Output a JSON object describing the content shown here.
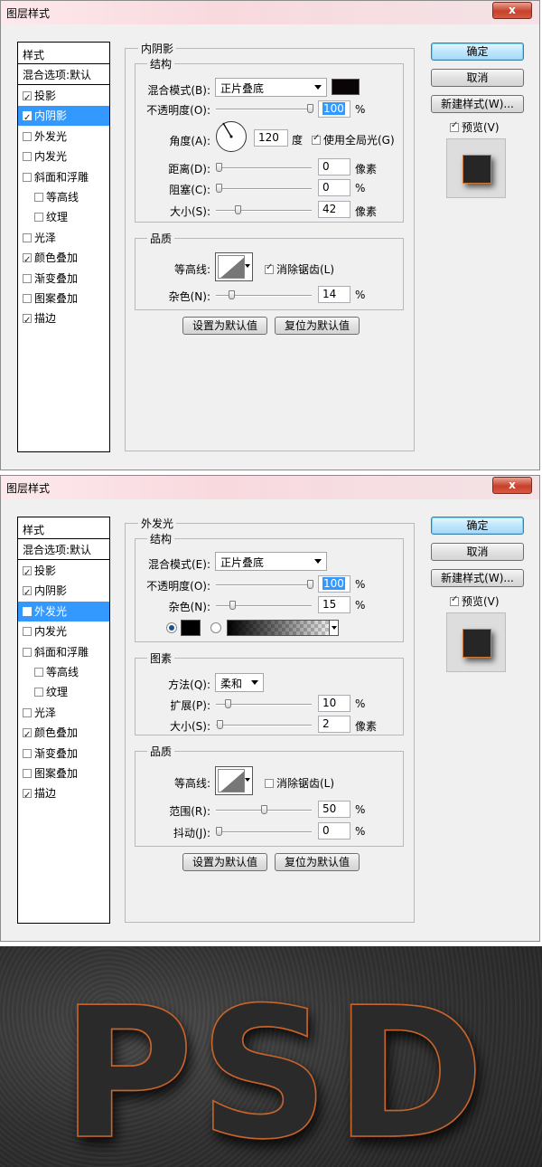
{
  "dialog_title": "图层样式",
  "close_glyph": "x",
  "style_list": {
    "header": "样式",
    "blend_default": "混合选项:默认",
    "items": [
      {
        "label": "投影",
        "checked": true,
        "indent": false
      },
      {
        "label": "内阴影",
        "checked": true,
        "indent": false
      },
      {
        "label": "外发光",
        "checked": false,
        "indent": false
      },
      {
        "label": "内发光",
        "checked": false,
        "indent": false
      },
      {
        "label": "斜面和浮雕",
        "checked": false,
        "indent": false
      },
      {
        "label": "等高线",
        "checked": false,
        "indent": true
      },
      {
        "label": "纹理",
        "checked": false,
        "indent": true
      },
      {
        "label": "光泽",
        "checked": false,
        "indent": false
      },
      {
        "label": "颜色叠加",
        "checked": true,
        "indent": false
      },
      {
        "label": "渐变叠加",
        "checked": false,
        "indent": false
      },
      {
        "label": "图案叠加",
        "checked": false,
        "indent": false
      },
      {
        "label": "描边",
        "checked": true,
        "indent": false
      }
    ]
  },
  "buttons": {
    "ok": "确定",
    "cancel": "取消",
    "new_style": "新建样式(W)...",
    "preview": "预览(V)",
    "set_default": "设置为默认值",
    "reset_default": "复位为默认值"
  },
  "dialog1": {
    "section": "内阴影",
    "selected_index": 1,
    "structure": {
      "legend": "结构",
      "blend_mode_label": "混合模式(B):",
      "blend_mode": "正片叠底",
      "blend_color": "#0a0406",
      "opacity_label": "不透明度(O):",
      "opacity": "100",
      "opacity_unit": "%",
      "angle_label": "角度(A):",
      "angle": "120",
      "angle_unit": "度",
      "global_light": "使用全局光(G)",
      "distance_label": "距离(D):",
      "distance": "0",
      "distance_unit": "像素",
      "choke_label": "阻塞(C):",
      "choke": "0",
      "choke_unit": "%",
      "size_label": "大小(S):",
      "size": "42",
      "size_unit": "像素"
    },
    "quality": {
      "legend": "品质",
      "contour_label": "等高线:",
      "anti_alias": "消除锯齿(L)",
      "anti_alias_checked": true,
      "noise_label": "杂色(N):",
      "noise": "14",
      "noise_unit": "%"
    }
  },
  "dialog2": {
    "section": "外发光",
    "selected_index": 2,
    "structure": {
      "legend": "结构",
      "blend_mode_label": "混合模式(E):",
      "blend_mode": "正片叠底",
      "opacity_label": "不透明度(O):",
      "opacity": "100",
      "opacity_unit": "%",
      "noise_label": "杂色(N):",
      "noise": "15",
      "noise_unit": "%",
      "glow_color": "#000000"
    },
    "elements": {
      "legend": "图素",
      "technique_label": "方法(Q):",
      "technique": "柔和",
      "spread_label": "扩展(P):",
      "spread": "10",
      "spread_unit": "%",
      "size_label": "大小(S):",
      "size": "2",
      "size_unit": "像素"
    },
    "quality": {
      "legend": "品质",
      "contour_label": "等高线:",
      "anti_alias": "消除锯齿(L)",
      "anti_alias_checked": false,
      "range_label": "范围(R):",
      "range": "50",
      "range_unit": "%",
      "jitter_label": "抖动(J):",
      "jitter": "0",
      "jitter_unit": "%"
    }
  },
  "artwork": {
    "text": "PSD",
    "stroke_color": "#c8642a"
  }
}
